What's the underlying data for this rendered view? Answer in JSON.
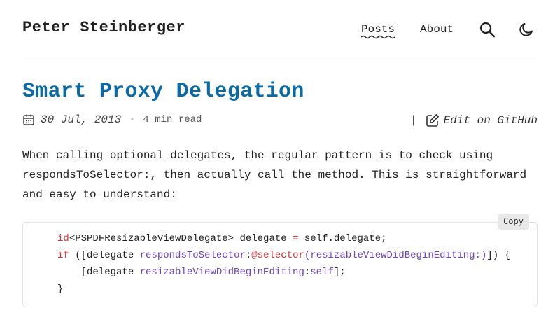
{
  "header": {
    "site_title": "Peter Steinberger",
    "nav": {
      "posts": "Posts",
      "about": "About"
    },
    "search_icon": "search-icon",
    "theme_icon": "moon-icon"
  },
  "post": {
    "title": "Smart Proxy Delegation",
    "date": "30 Jul, 2013",
    "read_time": "4 min read",
    "separator": "|",
    "edit_label": "Edit on GitHub",
    "intro": "When calling optional delegates, the regular pattern is to check using respondsToSelector:, then actually call the method. This is straightforward and easy to understand:"
  },
  "code": {
    "copy_label": "Copy",
    "line1": {
      "kw": "id",
      "rest": "<PSPDFResizableViewDelegate> delegate ",
      "op": "=",
      "tail": " self.delegate;"
    },
    "line2": {
      "kw": "if",
      "a": " ([delegate ",
      "fn1": "respondsToSelector",
      "colon": ":",
      "sel": "@selector",
      "arg": "(resizableViewDidBeginEditing:)",
      "tail": "]) {"
    },
    "line3": {
      "a": "    [delegate ",
      "fn": "resizableViewDidBeginEditing",
      "colon": ":",
      "kw": "self",
      "tail": "];"
    },
    "line4": "}"
  },
  "colors": {
    "title": "#0a6aa6",
    "keyword": "#d0343a",
    "function": "#6f42c1"
  }
}
